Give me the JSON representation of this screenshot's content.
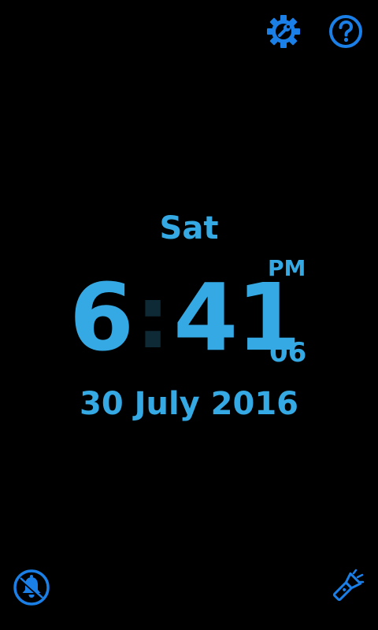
{
  "clock": {
    "day": "Sat",
    "hours": "6",
    "separator": ":",
    "minutes": "41",
    "ampm": "PM",
    "seconds": "06",
    "date": "30 July 2016"
  },
  "icons": {
    "settings": "settings-gear-wrench-icon",
    "help": "help-question-icon",
    "alarm": "alarm-bell-icon",
    "torch": "flashlight-icon"
  },
  "colors": {
    "text": "#35a9e3",
    "icon": "#1a7fe6",
    "colon_dim": "#0e2a36",
    "background": "#000000"
  }
}
